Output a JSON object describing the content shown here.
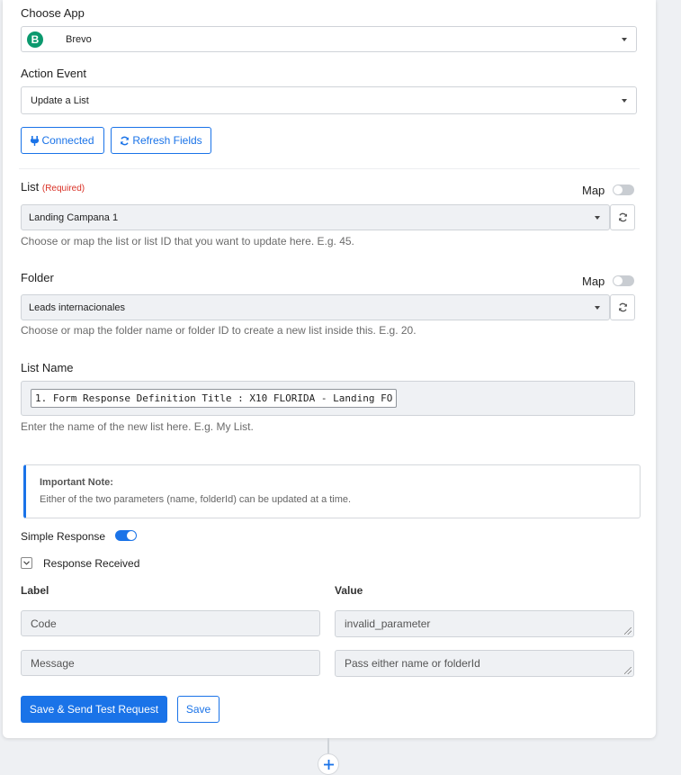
{
  "choose_app": {
    "label": "Choose App",
    "value": "Brevo",
    "logo_letter": "B",
    "logo_color": "#0b996e"
  },
  "action_event": {
    "label": "Action Event",
    "value": "Update a List"
  },
  "buttons": {
    "connected": "Connected",
    "refresh_fields": "Refresh Fields"
  },
  "list_field": {
    "label": "List",
    "required": "(Required)",
    "map_label": "Map",
    "value": "Landing Campana 1",
    "help": "Choose or map the list or list ID that you want to update here. E.g. 45."
  },
  "folder_field": {
    "label": "Folder",
    "map_label": "Map",
    "value": "Leads internacionales",
    "help": "Choose or map the folder name or folder ID to create a new list inside this. E.g. 20."
  },
  "list_name_field": {
    "label": "List Name",
    "token": "1. Form Response Definition Title : X10 FLORIDA - Landing FO",
    "help": "Enter the name of the new list here. E.g. My List."
  },
  "note": {
    "title": "Important Note:",
    "text": "Either of the two parameters (name, folderId) can be updated at a time."
  },
  "simple_response": {
    "label": "Simple Response",
    "enabled": true
  },
  "response_received": {
    "label": "Response Received"
  },
  "response_table": {
    "label_header": "Label",
    "value_header": "Value",
    "rows": [
      {
        "label": "Code",
        "value": "invalid_parameter"
      },
      {
        "label": "Message",
        "value": "Pass either name or folderId"
      }
    ]
  },
  "footer": {
    "save_send": "Save & Send Test Request",
    "save": "Save",
    "add_step_icon": "plus-icon"
  },
  "colors": {
    "accent": "#1a73e8",
    "required": "#d93025",
    "note_bar": "#1a73e8"
  }
}
